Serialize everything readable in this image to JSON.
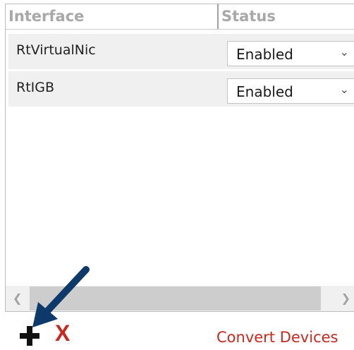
{
  "grid": {
    "columns": [
      "Interface",
      "Status"
    ],
    "rows": [
      {
        "interface": "RtVirtualNic",
        "status": "Enabled"
      },
      {
        "interface": "RtIGB",
        "status": "Enabled"
      }
    ]
  },
  "icons": {
    "dropdown": "chevron-down-icon",
    "scroll_left": "chevron-left-icon",
    "scroll_right": "chevron-right-icon",
    "add": "plus-icon",
    "remove": "x-icon",
    "pointer": "arrow-pointer-icon"
  },
  "toolbar": {
    "remove_label": "X",
    "convert_label": "Convert Devices"
  },
  "colors": {
    "accent_red": "#c8281e",
    "arrow_blue": "#0e3a6b"
  }
}
